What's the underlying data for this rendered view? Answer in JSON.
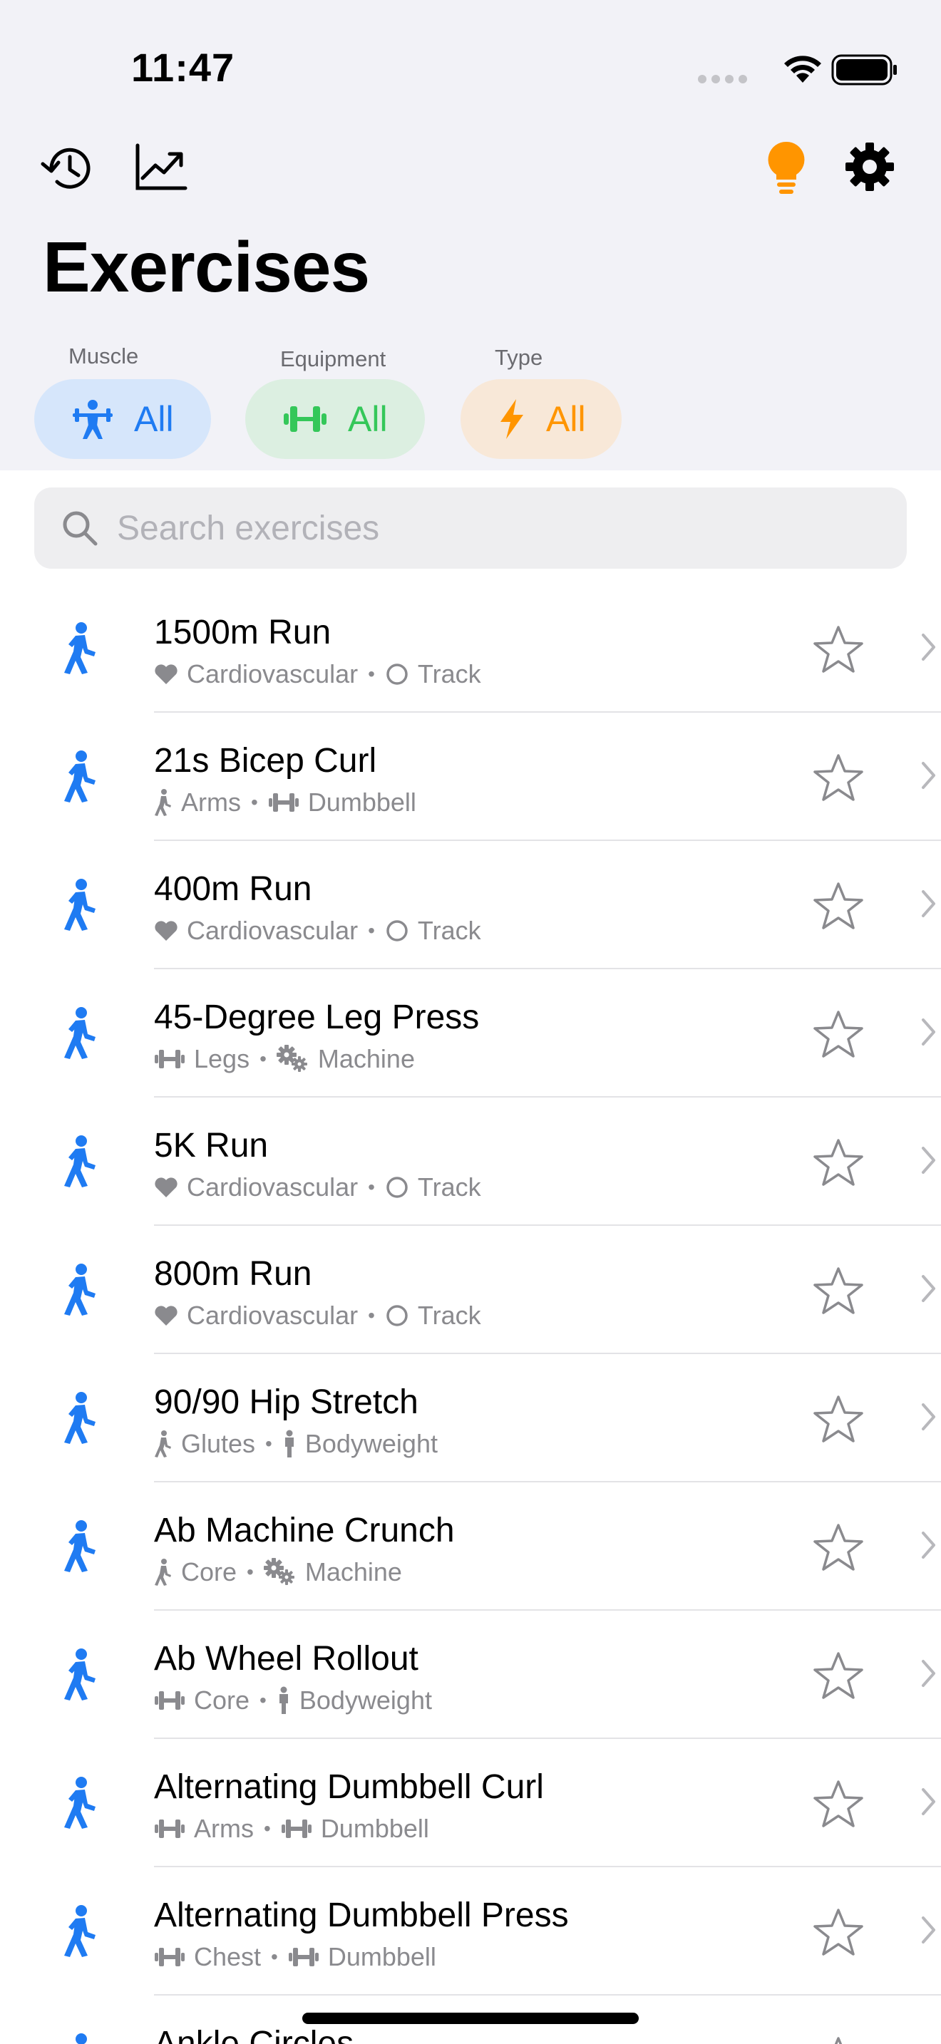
{
  "status": {
    "time": "11:47"
  },
  "header": {
    "title": "Exercises"
  },
  "filters": {
    "muscle": {
      "label": "Muscle",
      "value": "All"
    },
    "equipment": {
      "label": "Equipment",
      "value": "All"
    },
    "type": {
      "label": "Type",
      "value": "All"
    }
  },
  "search": {
    "placeholder": "Search exercises"
  },
  "colors": {
    "accent": "#1f7bf2",
    "equipment": "#34c759",
    "type": "#ff9500",
    "secondary": "#8a8a8e"
  },
  "exercises": [
    {
      "name": "1500m Run",
      "muscle": "Cardiovascular",
      "muscle_icon": "heart-icon",
      "equipment": "Track",
      "equipment_icon": "circle-icon"
    },
    {
      "name": "21s Bicep Curl",
      "muscle": "Arms",
      "muscle_icon": "walking-figure-icon",
      "equipment": "Dumbbell",
      "equipment_icon": "dumbbell-icon"
    },
    {
      "name": "400m Run",
      "muscle": "Cardiovascular",
      "muscle_icon": "heart-icon",
      "equipment": "Track",
      "equipment_icon": "circle-icon"
    },
    {
      "name": "45-Degree Leg Press",
      "muscle": "Legs",
      "muscle_icon": "dumbbell-icon",
      "equipment": "Machine",
      "equipment_icon": "gears-icon"
    },
    {
      "name": "5K Run",
      "muscle": "Cardiovascular",
      "muscle_icon": "heart-icon",
      "equipment": "Track",
      "equipment_icon": "circle-icon"
    },
    {
      "name": "800m Run",
      "muscle": "Cardiovascular",
      "muscle_icon": "heart-icon",
      "equipment": "Track",
      "equipment_icon": "circle-icon"
    },
    {
      "name": "90/90 Hip Stretch",
      "muscle": "Glutes",
      "muscle_icon": "walking-figure-icon",
      "equipment": "Bodyweight",
      "equipment_icon": "standing-person-icon"
    },
    {
      "name": "Ab Machine Crunch",
      "muscle": "Core",
      "muscle_icon": "walking-figure-icon",
      "equipment": "Machine",
      "equipment_icon": "gears-icon"
    },
    {
      "name": "Ab Wheel Rollout",
      "muscle": "Core",
      "muscle_icon": "dumbbell-icon",
      "equipment": "Bodyweight",
      "equipment_icon": "standing-person-icon"
    },
    {
      "name": "Alternating Dumbbell Curl",
      "muscle": "Arms",
      "muscle_icon": "dumbbell-icon",
      "equipment": "Dumbbell",
      "equipment_icon": "dumbbell-icon"
    },
    {
      "name": "Alternating Dumbbell Press",
      "muscle": "Chest",
      "muscle_icon": "dumbbell-icon",
      "equipment": "Dumbbell",
      "equipment_icon": "dumbbell-icon"
    },
    {
      "name": "Ankle Circles",
      "muscle": "",
      "muscle_icon": "",
      "equipment": "",
      "equipment_icon": ""
    }
  ]
}
